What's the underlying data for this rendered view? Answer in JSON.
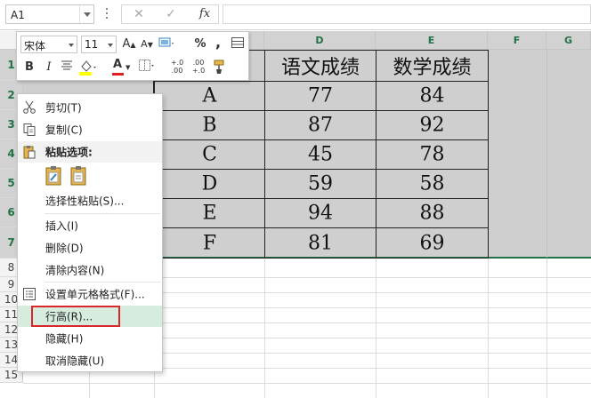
{
  "formula_bar": {
    "name_box": "A1",
    "cancel_glyph": "✕",
    "enter_glyph": "✓",
    "fx_label": "fx",
    "formula_value": ""
  },
  "columns": [
    {
      "label": ""
    },
    {
      "label": ""
    },
    {
      "label": ""
    },
    {
      "label": "D"
    },
    {
      "label": "E"
    },
    {
      "label": "F"
    },
    {
      "label": "G"
    }
  ],
  "rows": [
    "1",
    "2",
    "3",
    "4",
    "5",
    "6",
    "7",
    "8",
    "9",
    "10",
    "11",
    "12",
    "13",
    "14",
    "15"
  ],
  "table": {
    "headers": [
      "语文成绩",
      "数学成绩"
    ],
    "records": [
      {
        "name": "A",
        "chinese": "77",
        "math": "84"
      },
      {
        "name": "B",
        "chinese": "87",
        "math": "92"
      },
      {
        "name": "C",
        "chinese": "45",
        "math": "78"
      },
      {
        "name": "D",
        "chinese": "59",
        "math": "58"
      },
      {
        "name": "E",
        "chinese": "94",
        "math": "88"
      },
      {
        "name": "F",
        "chinese": "81",
        "math": "69"
      }
    ]
  },
  "mini_toolbar": {
    "font_name": "宋体",
    "font_size": "11",
    "grow_font": "A",
    "shrink_font": "A",
    "percent": "%",
    "comma": ",",
    "bold": "B",
    "italic": "I",
    "font_color_glyph": "A",
    "increase_decimal": "+.0 .00",
    "decrease_decimal": ".00 +.0",
    "font_color": "#e02020",
    "fill_color": "#ffff00"
  },
  "context_menu": {
    "items": [
      {
        "label": "剪切(T)",
        "icon": "scissors-icon"
      },
      {
        "label": "复制(C)",
        "icon": "copy-icon"
      },
      {
        "label": "粘贴选项:",
        "icon": "paste-icon"
      },
      {
        "label": "选择性粘贴(S)..."
      },
      {
        "label": "插入(I)"
      },
      {
        "label": "删除(D)"
      },
      {
        "label": "清除内容(N)"
      },
      {
        "label": "设置单元格格式(F)...",
        "icon": "format-cells-icon"
      },
      {
        "label": "行高(R)..."
      },
      {
        "label": "隐藏(H)"
      },
      {
        "label": "取消隐藏(U)"
      }
    ],
    "highlighted_item": "行高(R)...",
    "highlight_color": "#d5ecdf",
    "callout_color": "#d9262b"
  },
  "colors": {
    "accent": "#217346",
    "selection_band": "#cfcfcf"
  }
}
